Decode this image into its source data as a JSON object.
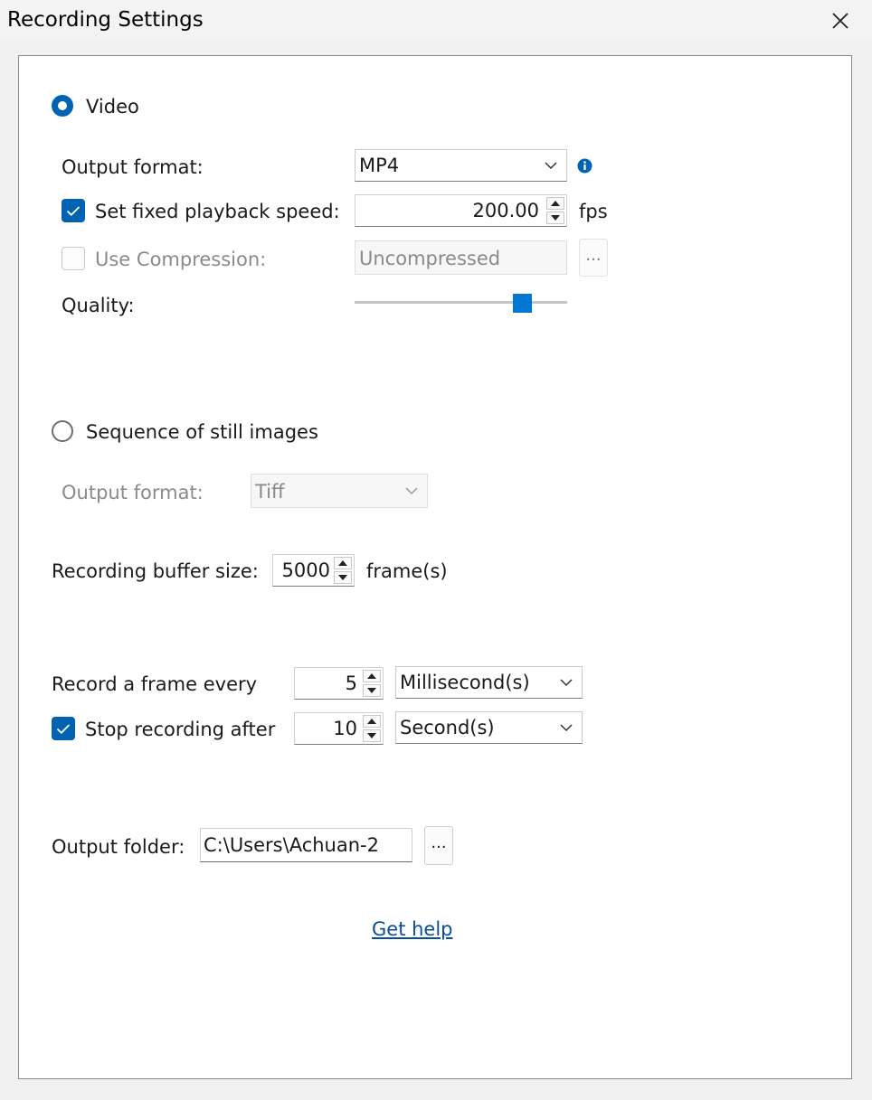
{
  "window": {
    "title": "Recording Settings"
  },
  "video": {
    "label": "Video",
    "selected": true,
    "output_format_label": "Output format:",
    "output_format_value": "MP4",
    "fixed_speed_label": "Set fixed playback speed:",
    "fixed_speed_checked": true,
    "fixed_speed_value": "200.00",
    "fixed_speed_unit": "fps",
    "compression_label": "Use Compression:",
    "compression_checked": false,
    "compression_value": "Uncompressed",
    "compression_button": "...",
    "quality_label": "Quality:",
    "quality_level": 0.82
  },
  "still": {
    "label": "Sequence of still images",
    "selected": false,
    "output_format_label": "Output format:",
    "output_format_value": "Tiff"
  },
  "buffer": {
    "label": "Recording buffer size:",
    "value": "5000",
    "unit": "frame(s)"
  },
  "record_every": {
    "label": "Record a frame every",
    "value": "5",
    "unit": "Millisecond(s)"
  },
  "stop_after": {
    "label": "Stop recording after",
    "checked": true,
    "value": "10",
    "unit": "Second(s)"
  },
  "output_folder": {
    "label": "Output folder:",
    "value": "C:\\Users\\Achuan-2",
    "button": "..."
  },
  "help": {
    "label": "Get help"
  },
  "colors": {
    "accent": "#0063b1",
    "link": "#0a4e9b",
    "slider_thumb": "#0078d4"
  }
}
